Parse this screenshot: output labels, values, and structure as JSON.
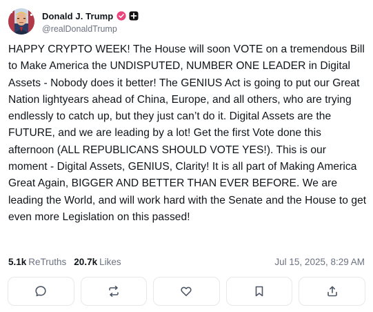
{
  "author": {
    "display_name": "Donald J. Trump",
    "handle": "@realDonaldTrump",
    "avatar_icon": "portrait-avatar-icon",
    "verified_icon": "verified-badge-icon",
    "verified_color": "#e8467c",
    "extra_badge_icon": "plus-square-icon"
  },
  "post": {
    "text": "HAPPY CRYPTO WEEK! The House will soon VOTE on a tremendous Bill to Make America the UNDISPUTED, NUMBER ONE LEADER in Digital Assets - Nobody does it better! The GENIUS Act is going to put our Great Nation lightyears ahead of China, Europe, and all others, who are trying endlessly to catch up, but they just can’t do it. Digital Assets are the FUTURE, and we are leading by a lot! Get the first Vote done this afternoon (ALL REPUBLICANS SHOULD VOTE YES!). This is our moment - Digital Assets, GENIUS, Clarity! It is all part of Making America Great Again, BIGGER AND BETTER THAN EVER BEFORE. We are leading the World, and will work hard with the Senate and the House to get even more Legislation on this passed!"
  },
  "stats": {
    "retruths_count": "5.1k",
    "retruths_label": "ReTruths",
    "likes_count": "20.7k",
    "likes_label": "Likes",
    "timestamp": "Jul 15, 2025, 8:29 AM"
  },
  "actions": [
    {
      "name": "reply",
      "icon": "comment-bubble-icon"
    },
    {
      "name": "retruth",
      "icon": "repost-arrows-icon"
    },
    {
      "name": "like",
      "icon": "heart-icon"
    },
    {
      "name": "bookmark",
      "icon": "bookmark-icon"
    },
    {
      "name": "share",
      "icon": "share-upload-icon"
    }
  ],
  "colors": {
    "text_primary": "#0f1419",
    "text_secondary": "#6b7280",
    "border": "#e6e8eb",
    "icon": "#4b5563"
  }
}
